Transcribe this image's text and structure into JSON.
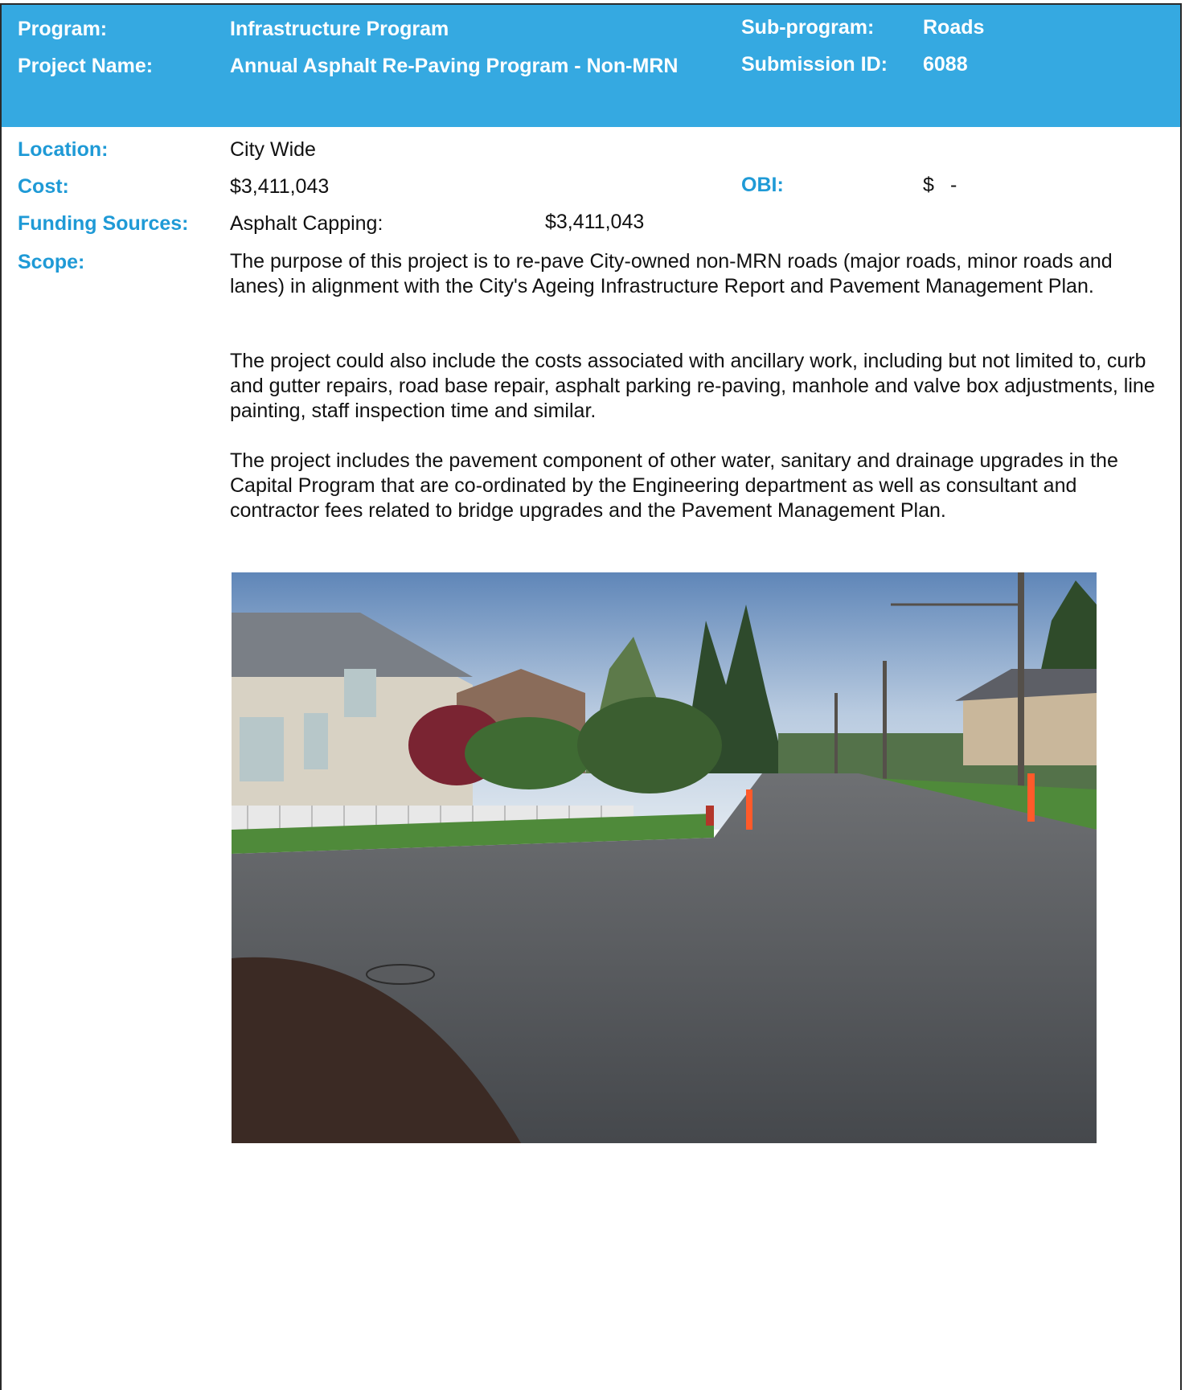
{
  "header": {
    "program_label": "Program:",
    "program_value": "Infrastructure Program",
    "subprogram_label": "Sub-program:",
    "subprogram_value": "Roads",
    "project_name_label": "Project Name:",
    "project_name_value": "Annual Asphalt Re-Paving Program - Non-MRN",
    "submission_id_label": "Submission ID:",
    "submission_id_value": "6088",
    "band_color": "#35a9e1"
  },
  "details": {
    "location_label": "Location:",
    "location_value": "City Wide",
    "cost_label": "Cost:",
    "cost_value": "$3,411,043",
    "obi_label": "OBI:",
    "obi_currency": "$",
    "obi_value": "-",
    "funding_label": "Funding Sources:",
    "funding_source_name": "Asphalt Capping:",
    "funding_source_amount": "$3,411,043",
    "scope_label": "Scope:",
    "label_color": "#1f9ad6"
  },
  "scope": {
    "paragraphs": [
      "The purpose of this project is to re-pave City-owned non-MRN roads (major roads, minor roads and lanes) in alignment with the City's Ageing Infrastructure Report and Pavement Management Plan.",
      "The project could also include the costs associated with ancillary work, including but not limited to, curb and gutter repairs, road base repair, asphalt parking re-paving, manhole and valve box adjustments, line painting, staff inspection time and similar.",
      "The project includes the pavement component of other water, sanitary and drainage upgrades in the Capital Program that are co-ordinated by the Engineering department as well as consultant and contractor fees related to bridge upgrades and the Pavement Management Plan."
    ]
  },
  "photo": {
    "icon": "street-photo"
  }
}
